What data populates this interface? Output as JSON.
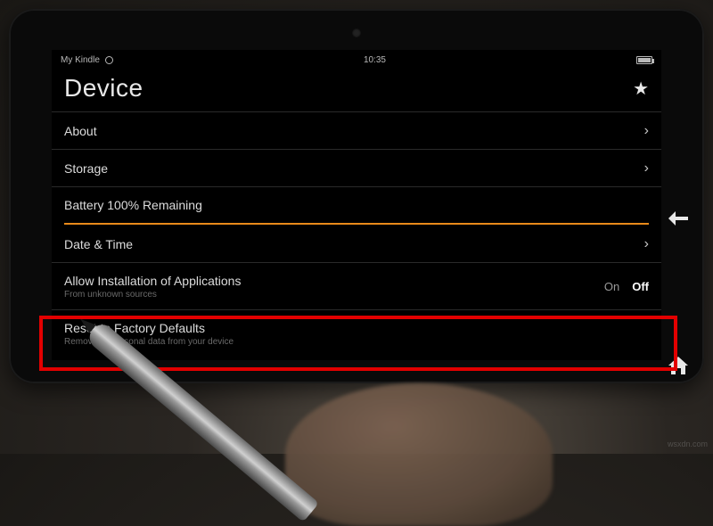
{
  "statusbar": {
    "title": "My Kindle",
    "time": "10:35"
  },
  "page": {
    "title": "Device"
  },
  "rows": {
    "about": {
      "label": "About"
    },
    "storage": {
      "label": "Storage"
    },
    "battery": {
      "label": "Battery 100% Remaining"
    },
    "datetime": {
      "label": "Date & Time"
    },
    "allow_install": {
      "label": "Allow Installation of Applications",
      "sub": "From unknown sources",
      "on": "On",
      "off": "Off"
    },
    "reset": {
      "label": "Reset to Factory Defaults",
      "sub": "Remove all personal data from your device"
    }
  },
  "watermark": "wsxdn.com"
}
